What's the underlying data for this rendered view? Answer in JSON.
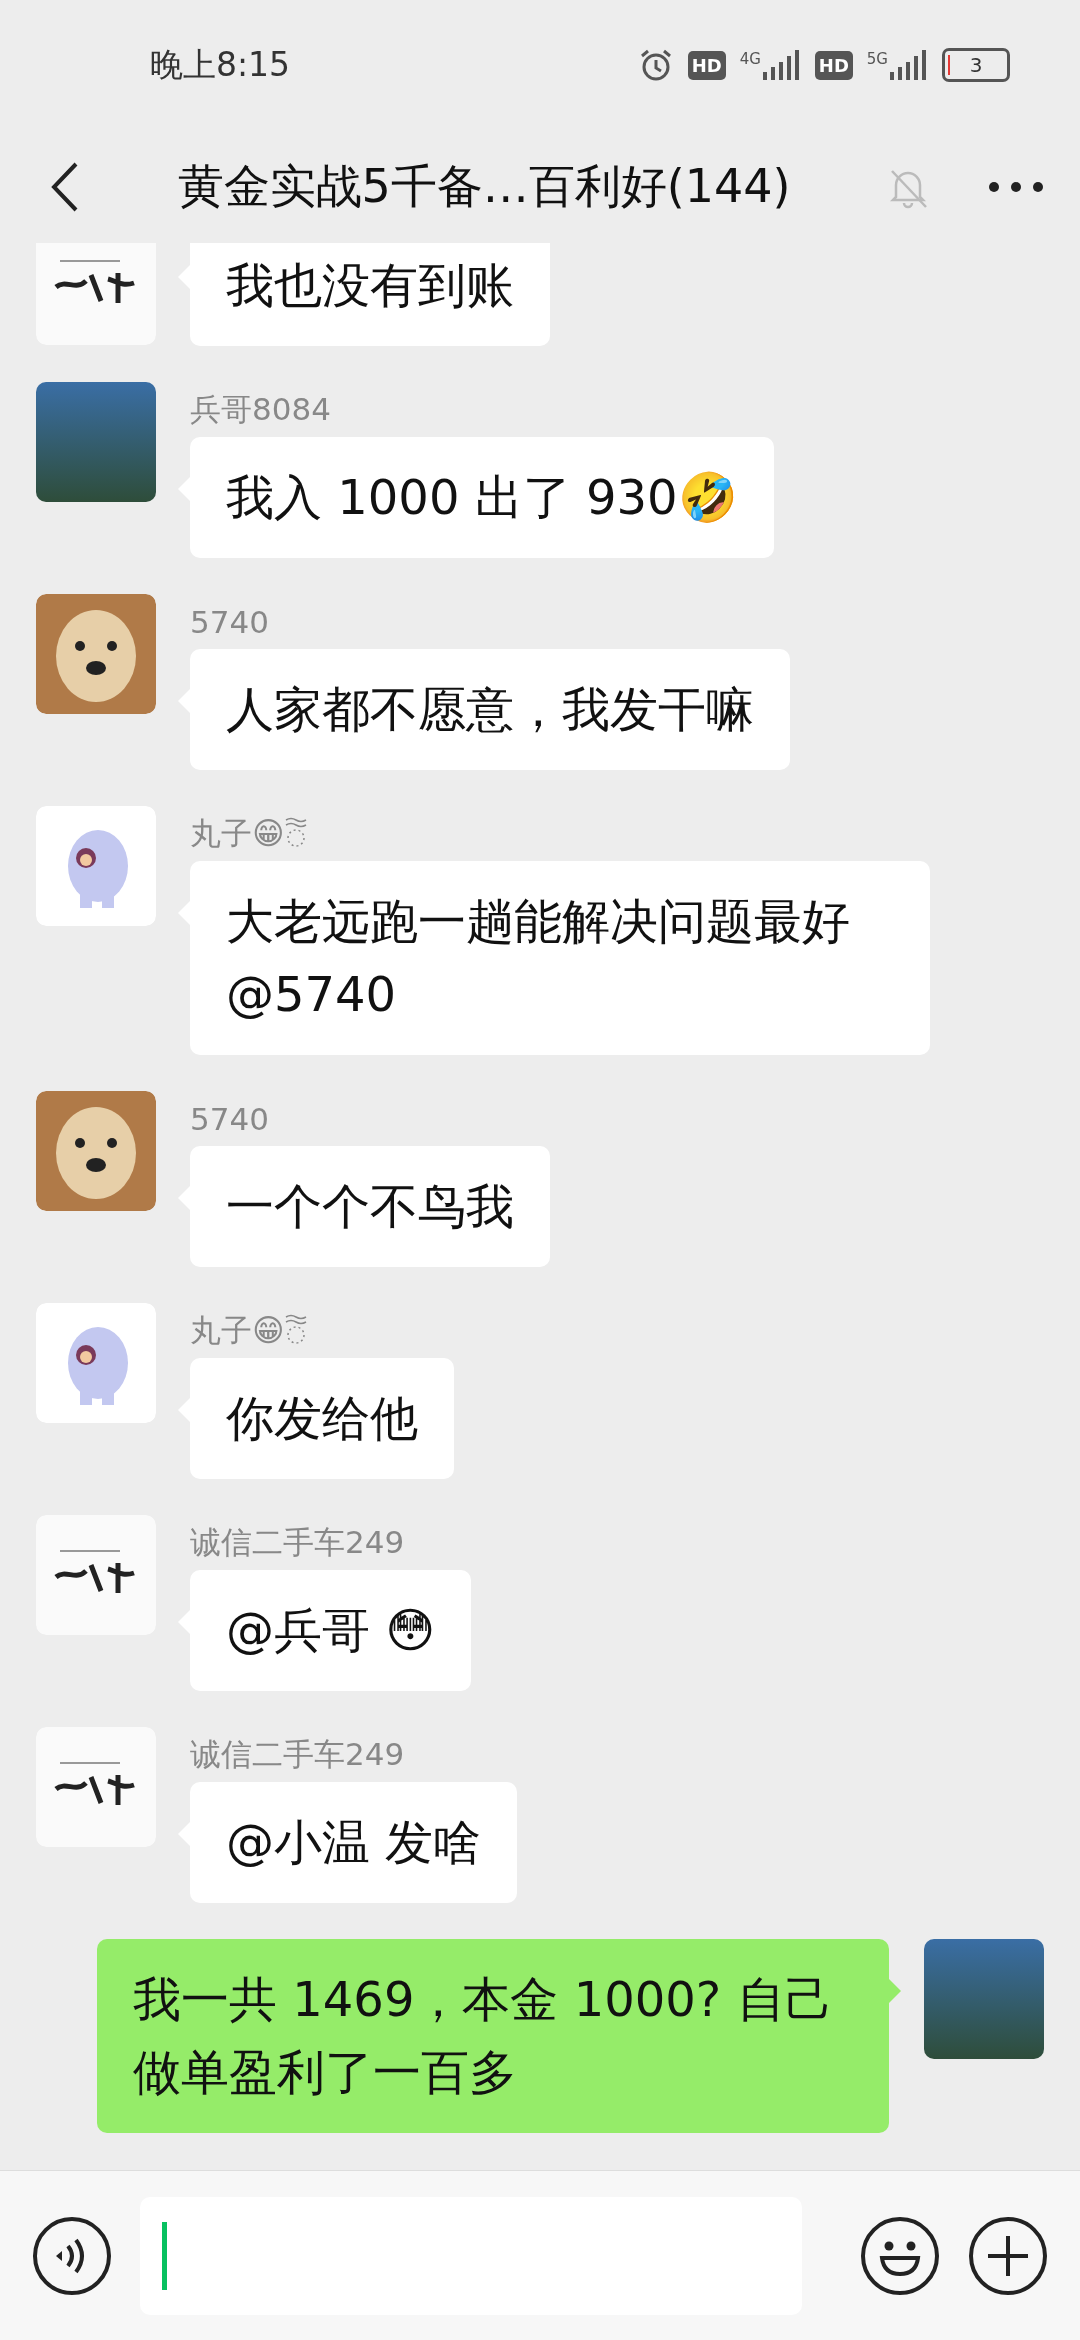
{
  "status_bar": {
    "time": "晚上8:15",
    "indicators": [
      {
        "kind": "alarm"
      },
      {
        "kind": "hd",
        "label": "HD"
      },
      {
        "kind": "signal",
        "label": "4G"
      },
      {
        "kind": "hd",
        "label": "HD"
      },
      {
        "kind": "signal",
        "label": "5G"
      },
      {
        "kind": "battery",
        "label": "3",
        "level": 0.04
      }
    ]
  },
  "header": {
    "title": "黄金实战5千备…百利好(144)",
    "muted": true
  },
  "messages": [
    {
      "kind": "incoming",
      "avatar": {
        "kind": "calligraphy"
      },
      "text": "我也没有到账"
    },
    {
      "kind": "incoming",
      "sender": "兵哥8084",
      "avatar": {
        "kind": "photo"
      },
      "text": "我入 1000 出了 930🤣"
    },
    {
      "kind": "incoming",
      "sender": "5740",
      "avatar": {
        "kind": "dog"
      },
      "text": "人家都不愿意，我发干嘛"
    },
    {
      "kind": "incoming",
      "sender": "丸子😁",
      "sender_badge": true,
      "avatar": {
        "kind": "elephant"
      },
      "text": "大老远跑一趟能解决问题最好@5740"
    },
    {
      "kind": "incoming",
      "sender": "5740",
      "avatar": {
        "kind": "dog"
      },
      "text": "一个个不鸟我"
    },
    {
      "kind": "incoming",
      "sender": "丸子😁",
      "sender_badge": true,
      "avatar": {
        "kind": "elephant"
      },
      "text": "你发给他"
    },
    {
      "kind": "incoming",
      "sender": "诚信二手车249",
      "avatar": {
        "kind": "calligraphy"
      },
      "text": "@兵哥 😳"
    },
    {
      "kind": "incoming",
      "sender": "诚信二手车249",
      "avatar": {
        "kind": "calligraphy"
      },
      "text": "@小温  发啥"
    },
    {
      "kind": "outgoing",
      "avatar": {
        "kind": "photo"
      },
      "text": "我一共 1469，本金 1000? 自己做单盈利了一百多"
    }
  ],
  "input_bar": {
    "focused": true
  }
}
